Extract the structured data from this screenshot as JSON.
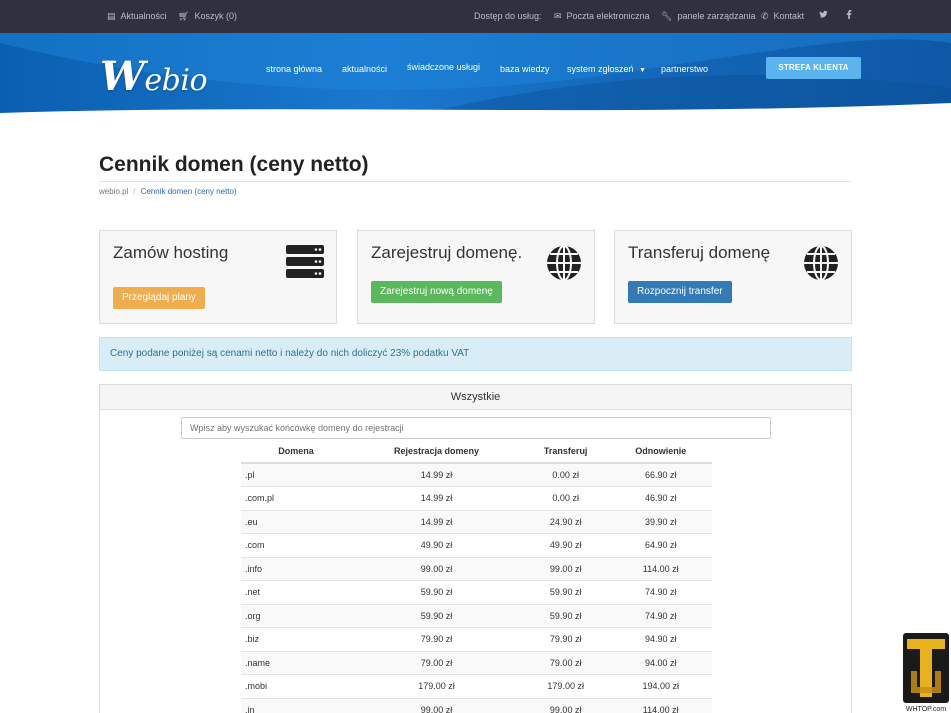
{
  "topbar": {
    "news": "Aktualności",
    "cart": "Koszyk (0)",
    "access": "Dostęp do usług:",
    "mail": "Poczta elektroniczna",
    "panels": "panele zarządzania",
    "contact": "Kontakt"
  },
  "brand": {
    "logo_w": "W",
    "logo_rest": "ebio"
  },
  "nav": {
    "items": [
      "strona główna",
      "aktualności",
      "świadczone usługi",
      "baza wiedzy",
      "system zgłoszeń",
      "partnerstwo"
    ],
    "client_button": "STREFA KLIENTA"
  },
  "page": {
    "title": "Cennik domen (ceny netto)",
    "breadcrumb": [
      "webio.pl",
      "Cennik domen (ceny netto)"
    ]
  },
  "cards": [
    {
      "title": "Zamów hosting",
      "button": "Przeglądaj plany",
      "color": "#f0ad4e",
      "icon": "server-icon"
    },
    {
      "title": "Zarejestruj domenę.",
      "button": "Zarejestruj nową domenę",
      "color": "#5cb85c",
      "icon": "globe-icon"
    },
    {
      "title": "Transferuj domenę",
      "button": "Rozpocznij transfer",
      "color": "#337ab7",
      "icon": "globe-icon"
    }
  ],
  "alert": "Ceny podane poniżej są cenami netto i należy do nich doliczyć 23% podatku VAT",
  "panel": {
    "heading": "Wszystkie",
    "search_placeholder": "Wpisz aby wyszukać końcówkę domeny do rejestracji",
    "columns": [
      "Domena",
      "Rejestracja domeny",
      "Transferuj",
      "Odnowienie"
    ],
    "rows": [
      [
        ".pl",
        "14.99 zł",
        "0.00 zł",
        "66.90 zł"
      ],
      [
        ".com.pl",
        "14.99 zł",
        "0.00 zł",
        "46.90 zł"
      ],
      [
        ".eu",
        "14.99 zł",
        "24.90 zł",
        "39.90 zł"
      ],
      [
        ".com",
        "49.90 zł",
        "49.90 zł",
        "64.90 zł"
      ],
      [
        ".info",
        "99.00 zł",
        "99.00 zł",
        "114.00 zł"
      ],
      [
        ".net",
        "59.90 zł",
        "59.90 zł",
        "74.90 zł"
      ],
      [
        ".org",
        "59.90 zł",
        "59.90 zł",
        "74.90 zł"
      ],
      [
        ".biz",
        "79.90 zł",
        "79.90 zł",
        "94.90 zł"
      ],
      [
        ".name",
        "79.00 zł",
        "79.00 zł",
        "94.00 zł"
      ],
      [
        ".mobi",
        "179.00 zł",
        "179.00 zł",
        "194.00 zł"
      ],
      [
        ".in",
        "99.00 zł",
        "99.00 zł",
        "114.00 zł"
      ]
    ]
  },
  "watermark": "WHTOP.com"
}
